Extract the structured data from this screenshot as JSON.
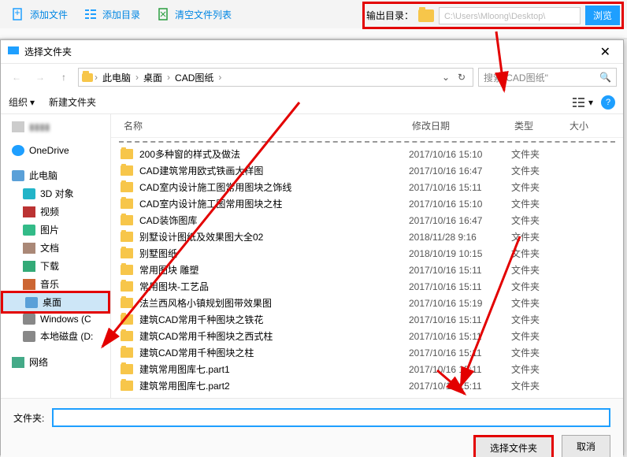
{
  "toolbar": {
    "addFile": "添加文件",
    "addDir": "添加目录",
    "clearList": "清空文件列表",
    "outputLabel": "输出目录：",
    "outputPath": "C:\\Users\\Mloong\\Desktop\\",
    "browse": "浏览"
  },
  "dialog": {
    "title": "选择文件夹",
    "breadcrumb": [
      "此电脑",
      "桌面",
      "CAD图纸"
    ],
    "searchPlaceholder": "搜索\"CAD图纸\"",
    "organize": "组织",
    "newFolder": "新建文件夹",
    "columns": {
      "name": "名称",
      "date": "修改日期",
      "type": "类型",
      "size": "大小"
    },
    "tree": [
      {
        "label": "OneDrive",
        "icon": "ic-cloud"
      },
      {
        "label": "此电脑",
        "icon": "ic-pc",
        "bold": true
      },
      {
        "label": "3D 对象",
        "icon": "ic-3d",
        "sub": true
      },
      {
        "label": "视频",
        "icon": "ic-vid",
        "sub": true
      },
      {
        "label": "图片",
        "icon": "ic-img",
        "sub": true
      },
      {
        "label": "文档",
        "icon": "ic-doc",
        "sub": true
      },
      {
        "label": "下载",
        "icon": "ic-dl",
        "sub": true
      },
      {
        "label": "音乐",
        "icon": "ic-music",
        "sub": true
      },
      {
        "label": "桌面",
        "icon": "ic-pc",
        "sub": true,
        "selected": true
      },
      {
        "label": "Windows (C",
        "icon": "ic-drive",
        "sub": true
      },
      {
        "label": "本地磁盘 (D:",
        "icon": "ic-drive",
        "sub": true
      },
      {
        "label": "网络",
        "icon": "ic-net"
      }
    ],
    "files": [
      {
        "name": "200多种窗的样式及做法",
        "date": "2017/10/16 15:10",
        "type": "文件夹"
      },
      {
        "name": "CAD建筑常用欧式铁画大样图",
        "date": "2017/10/16 16:47",
        "type": "文件夹"
      },
      {
        "name": "CAD室内设计施工图常用图块之饰线",
        "date": "2017/10/16 15:11",
        "type": "文件夹"
      },
      {
        "name": "CAD室内设计施工图常用图块之柱",
        "date": "2017/10/16 15:10",
        "type": "文件夹"
      },
      {
        "name": "CAD装饰图库",
        "date": "2017/10/16 16:47",
        "type": "文件夹"
      },
      {
        "name": "别墅设计图纸及效果图大全02",
        "date": "2018/11/28 9:16",
        "type": "文件夹"
      },
      {
        "name": "别墅图纸",
        "date": "2018/10/19 10:15",
        "type": "文件夹"
      },
      {
        "name": "常用图块 雕塑",
        "date": "2017/10/16 15:11",
        "type": "文件夹"
      },
      {
        "name": "常用图块-工艺品",
        "date": "2017/10/16 15:11",
        "type": "文件夹"
      },
      {
        "name": "法兰西风格小镇规划图带效果图",
        "date": "2017/10/16 15:19",
        "type": "文件夹"
      },
      {
        "name": "建筑CAD常用千种图块之铁花",
        "date": "2017/10/16 15:11",
        "type": "文件夹"
      },
      {
        "name": "建筑CAD常用千种图块之西式柱",
        "date": "2017/10/16 15:11",
        "type": "文件夹"
      },
      {
        "name": "建筑CAD常用千种图块之柱",
        "date": "2017/10/16 15:11",
        "type": "文件夹"
      },
      {
        "name": "建筑常用图库七.part1",
        "date": "2017/10/16 15:11",
        "type": "文件夹"
      },
      {
        "name": "建筑常用图库七.part2",
        "date": "2017/10/16 15:11",
        "type": "文件夹"
      }
    ],
    "folderLabel": "文件夹:",
    "selectBtn": "选择文件夹",
    "cancelBtn": "取消"
  }
}
